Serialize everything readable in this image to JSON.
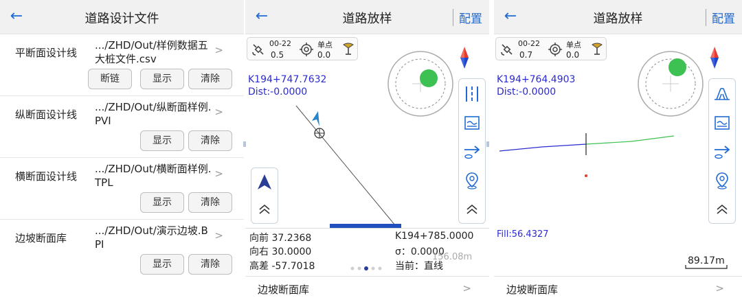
{
  "screen1": {
    "title": "道路设计文件",
    "rows": [
      {
        "label": "平断面设计线",
        "path": ".../ZHD/Out/样例数据五大桩文件.csv",
        "buttons": [
          "断链",
          "显示",
          "清除"
        ]
      },
      {
        "label": "纵断面设计线",
        "path": ".../ZHD/Out/纵断面样例.PVI",
        "buttons": [
          "显示",
          "清除"
        ]
      },
      {
        "label": "横断面设计线",
        "path": ".../ZHD/Out/横断面样例.TPL",
        "buttons": [
          "显示",
          "清除"
        ]
      },
      {
        "label": "边坡断面库",
        "path": ".../ZHD/Out/演示边坡.BPI",
        "buttons": [
          "显示",
          "清除"
        ]
      }
    ]
  },
  "screen2": {
    "title": "道路放样",
    "config": "配置",
    "status_code": "00-22",
    "status_val": "0.5",
    "mode": "单点",
    "mode_val": "0.0",
    "station": "K194+747.7632",
    "dist": "Dist:-0.0000",
    "forward": "向前 37.2368",
    "right": "向右 30.0000",
    "elev": "高差 -57.7018",
    "target_station": "K194+785.0000",
    "sigma": "σ：0.0000",
    "current": "当前：直线",
    "scale": "156.08m",
    "bottom": "边坡断面库"
  },
  "screen3": {
    "title": "道路放样",
    "config": "配置",
    "status_code": "00-22",
    "status_val": "0.7",
    "mode": "单点",
    "mode_val": "0.0",
    "station": "K194+764.4903",
    "dist": "Dist:-0.0000",
    "fill": "Fill:56.4327",
    "scale": "89.17m",
    "bottom": "边坡断面库"
  },
  "colors": {
    "accent": "#1f6ad4",
    "green": "#3cc152",
    "station_blue": "#2a2ad0"
  }
}
